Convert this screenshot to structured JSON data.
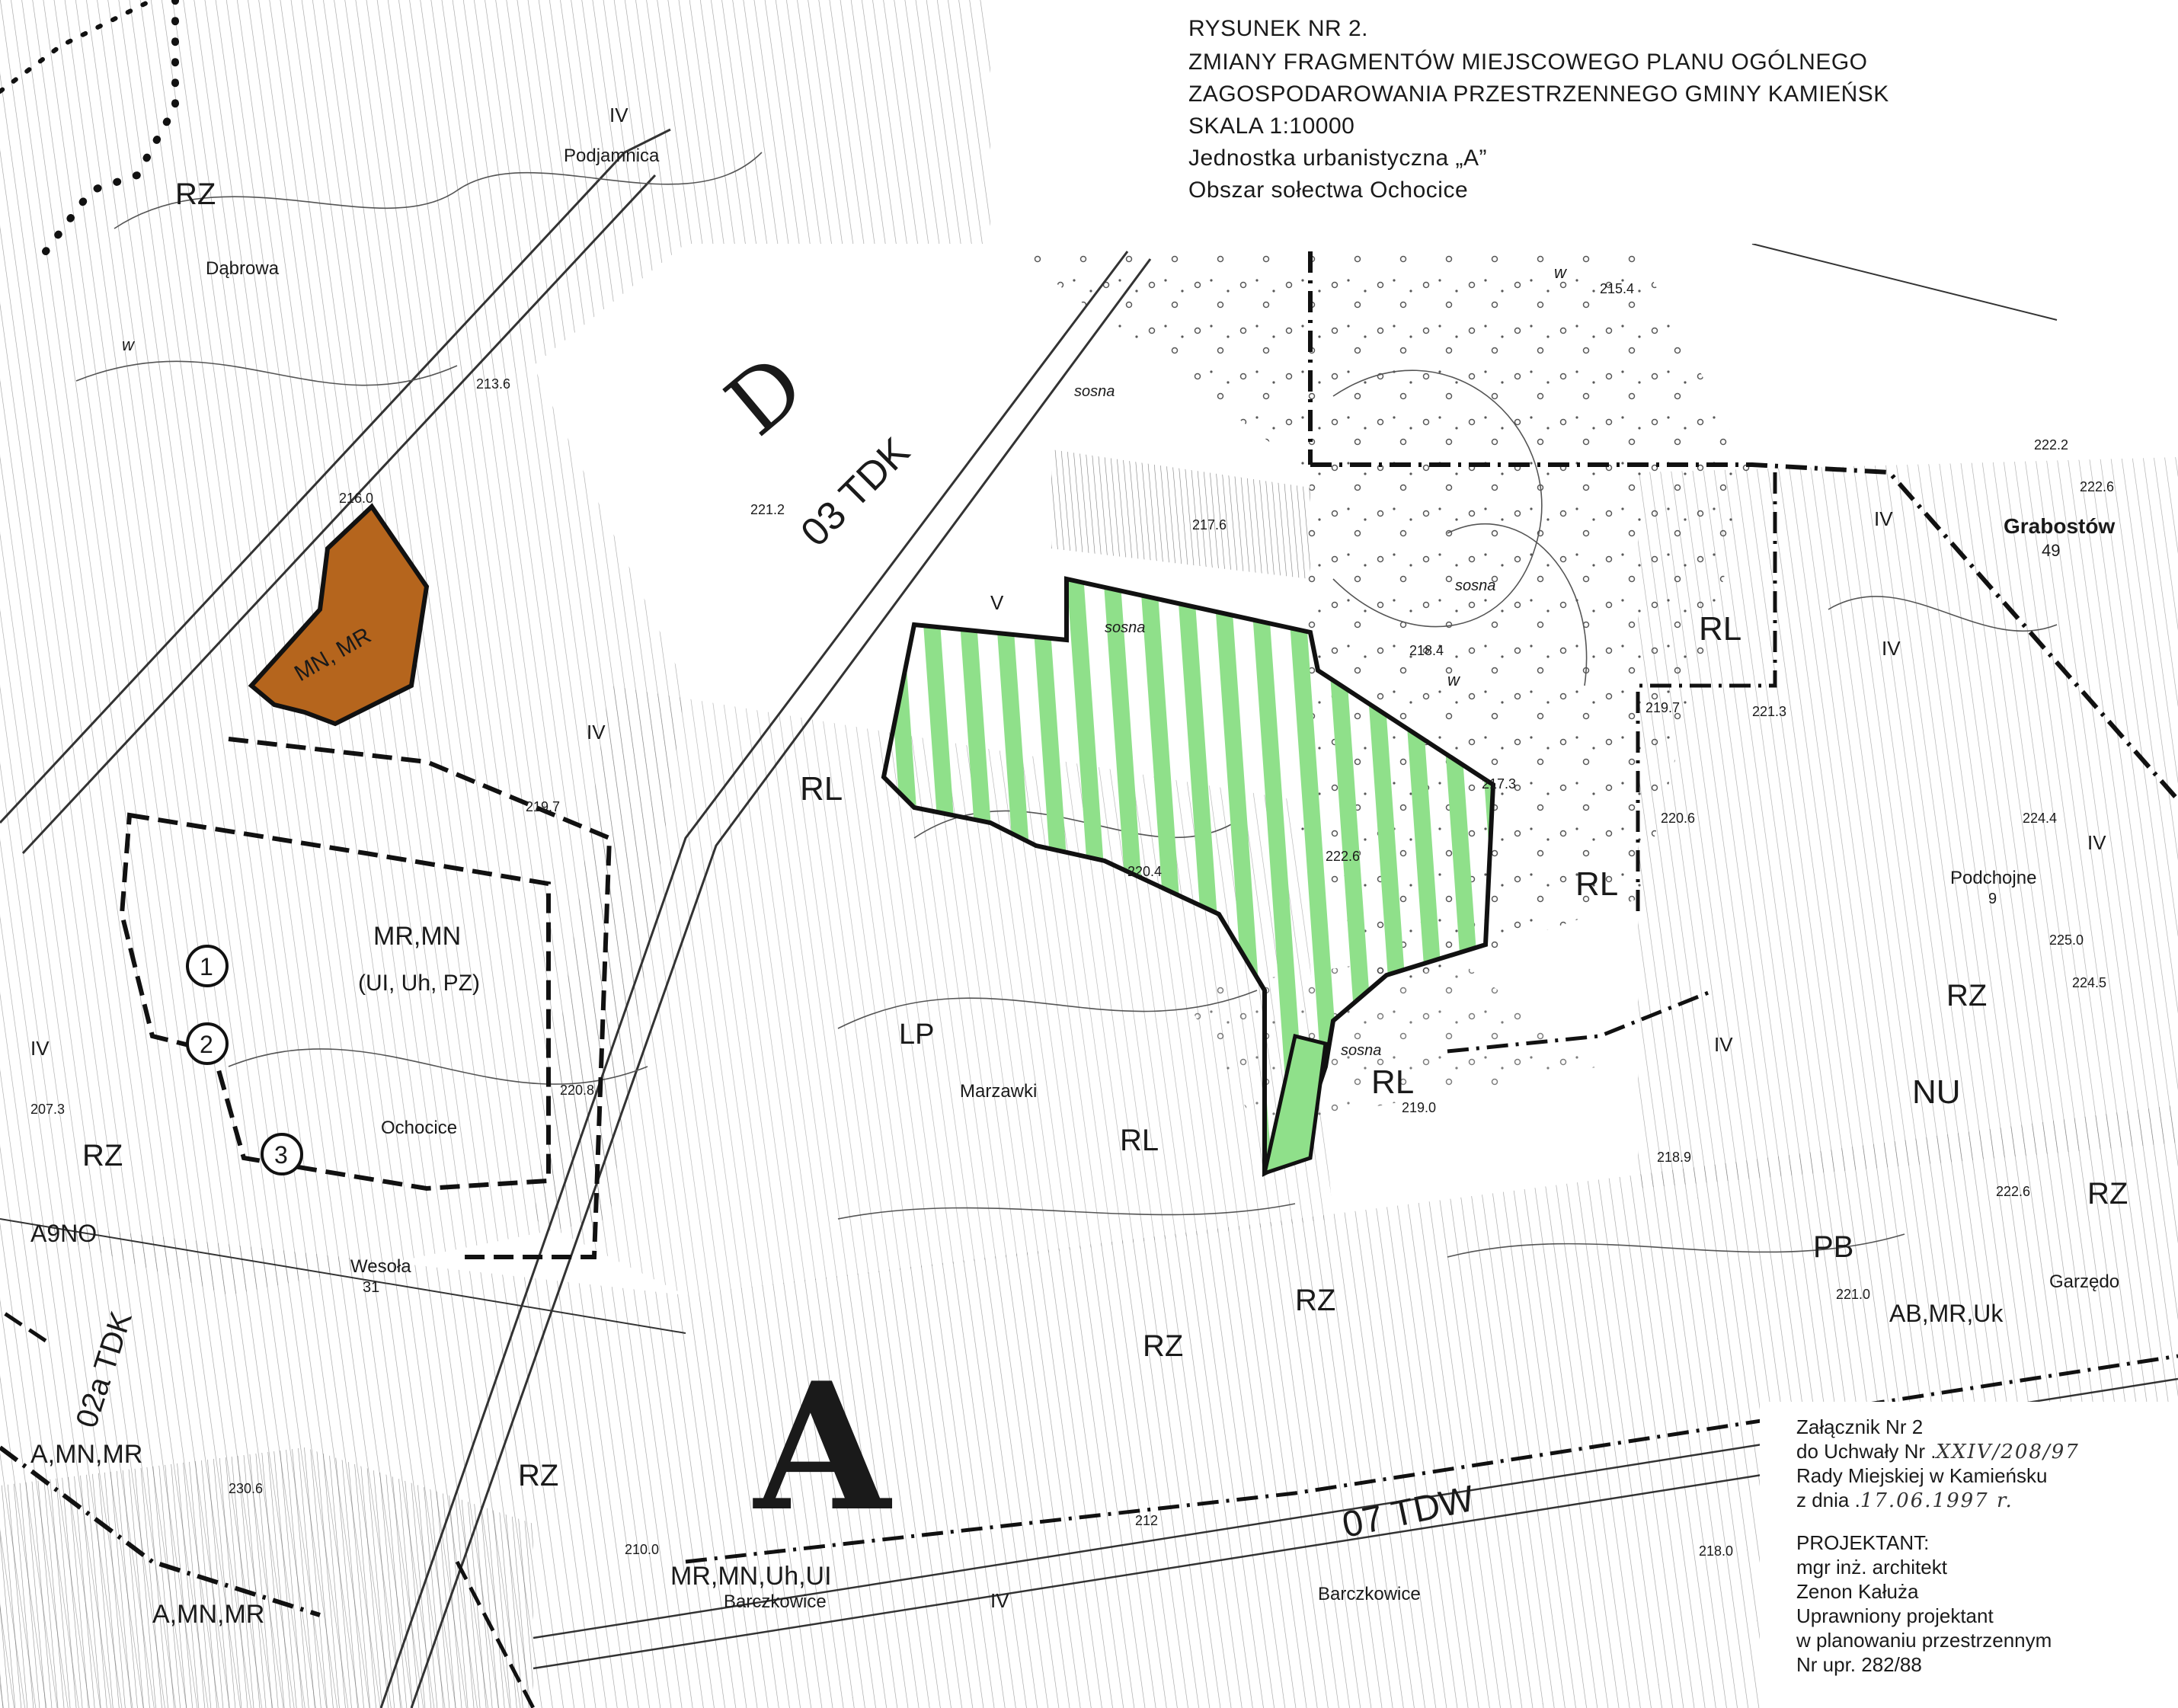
{
  "title_block": {
    "line1": "RYSUNEK NR 2.",
    "line2": "ZMIANY FRAGMENTÓW MIEJSCOWEGO PLANU OGÓLNEGO",
    "line3": "ZAGOSPODAROWANIA PRZESTRZENNEGO GMINY KAMIEŃSK",
    "line4": "SKALA 1:10000",
    "line5": "Jednostka urbanistyczna „A”",
    "line6": "Obszar sołectwa Ochocice"
  },
  "annex": {
    "line1": "Załącznik Nr 2",
    "line2_prefix": "do Uchwały Nr .",
    "line2_value": "XXIV/208/97",
    "line3": "Rady Miejskiej w Kamieńsku",
    "line4_prefix": "z dnia .",
    "line4_value": "17.06.1997 r.",
    "line5": "PROJEKTANT:",
    "line6": "mgr inż. architekt",
    "line7": "Zenon Kałuża",
    "line8": "Uprawniony projektant",
    "line9": "w planowaniu przestrzennym",
    "line10": "Nr upr. 282/88"
  },
  "map": {
    "places": {
      "podjamnica": "Podjamnica",
      "dabrowa": "Dąbrowa",
      "grabostow": "Grabostów",
      "grabostow_num": "49",
      "podchojne": "Podchojne",
      "podchojne_num": "9",
      "ochocice": "Ochocice",
      "wesola": "Wesoła",
      "wesola_num": "31",
      "marzawki": "Marzawki",
      "barczkowice_1": "Barczkowice",
      "barczkowice_2": "Barczkowice",
      "garzedow": "Garzędo"
    },
    "zones": {
      "rz_nw": "RZ",
      "rz_mid": "RZ",
      "rz_sw": "RZ",
      "rz_south": "RZ",
      "rz_south2": "RZ",
      "rz_east": "RZ",
      "rz_east2": "RZ",
      "rl_centre": "RL",
      "rl_east": "RL",
      "rl_east2": "RL",
      "rl_south": "RL",
      "rl_mid": "RL",
      "lp": "LP",
      "nu": "NU",
      "pb": "PB",
      "mr_mn": "MR,MN",
      "mr_mn_sub": "(UI, Uh, PZ)",
      "zone_orange": "MN, MR",
      "d_label": "D",
      "unit_a": "A",
      "almn_mr": "A,MN,MR",
      "a_mn_mr_s": "A,MN,MR",
      "mr_mn_s": "MR,MN,Uh,UI",
      "abmr": "AB,MR,Uk",
      "a9no": "A9NO",
      "road_03": "03 TDK",
      "road_07": "07 TDW",
      "road_02": "02a TDK",
      "circle1": "1",
      "circle2": "2",
      "circle3": "3"
    },
    "forest": {
      "sosna1": "sosna",
      "sosna2": "sosna",
      "sosna3": "sosna",
      "sosna4": "sosna"
    },
    "classes": {
      "iv_1": "IV",
      "iv_2": "IV",
      "iv_3": "IV",
      "iv_4": "IV",
      "iv_5": "IV",
      "iv_6": "IV",
      "iv_7": "IV",
      "iv_8": "IV",
      "v_1": "V",
      "w_1": "w",
      "w_2": "w",
      "w_3": "w"
    },
    "heights": {
      "h1": "213.6",
      "h2": "216.0",
      "h3": "221.2",
      "h4": "217.6",
      "h5": "218.4",
      "h6": "215.4",
      "h7": "222.2",
      "h8": "222.6",
      "h9": "219.7",
      "h10": "221.3",
      "h11": "220.6",
      "h12": "217.3",
      "h13": "222.6",
      "h14": "220.4",
      "h15": "219.0",
      "h16": "218.9",
      "h17": "221.0",
      "h18": "222.6",
      "h19": "224.4",
      "h20": "225.0",
      "h21": "224.5",
      "h22": "218.0",
      "h23": "219.7",
      "h24": "230.6",
      "h25": "207.3",
      "h26": "220.8",
      "h27": "212",
      "h28": "210.0"
    },
    "colors": {
      "change_area_orange": "#b5651d",
      "change_area_green": "#8fe08a",
      "linework": "#222222"
    }
  }
}
